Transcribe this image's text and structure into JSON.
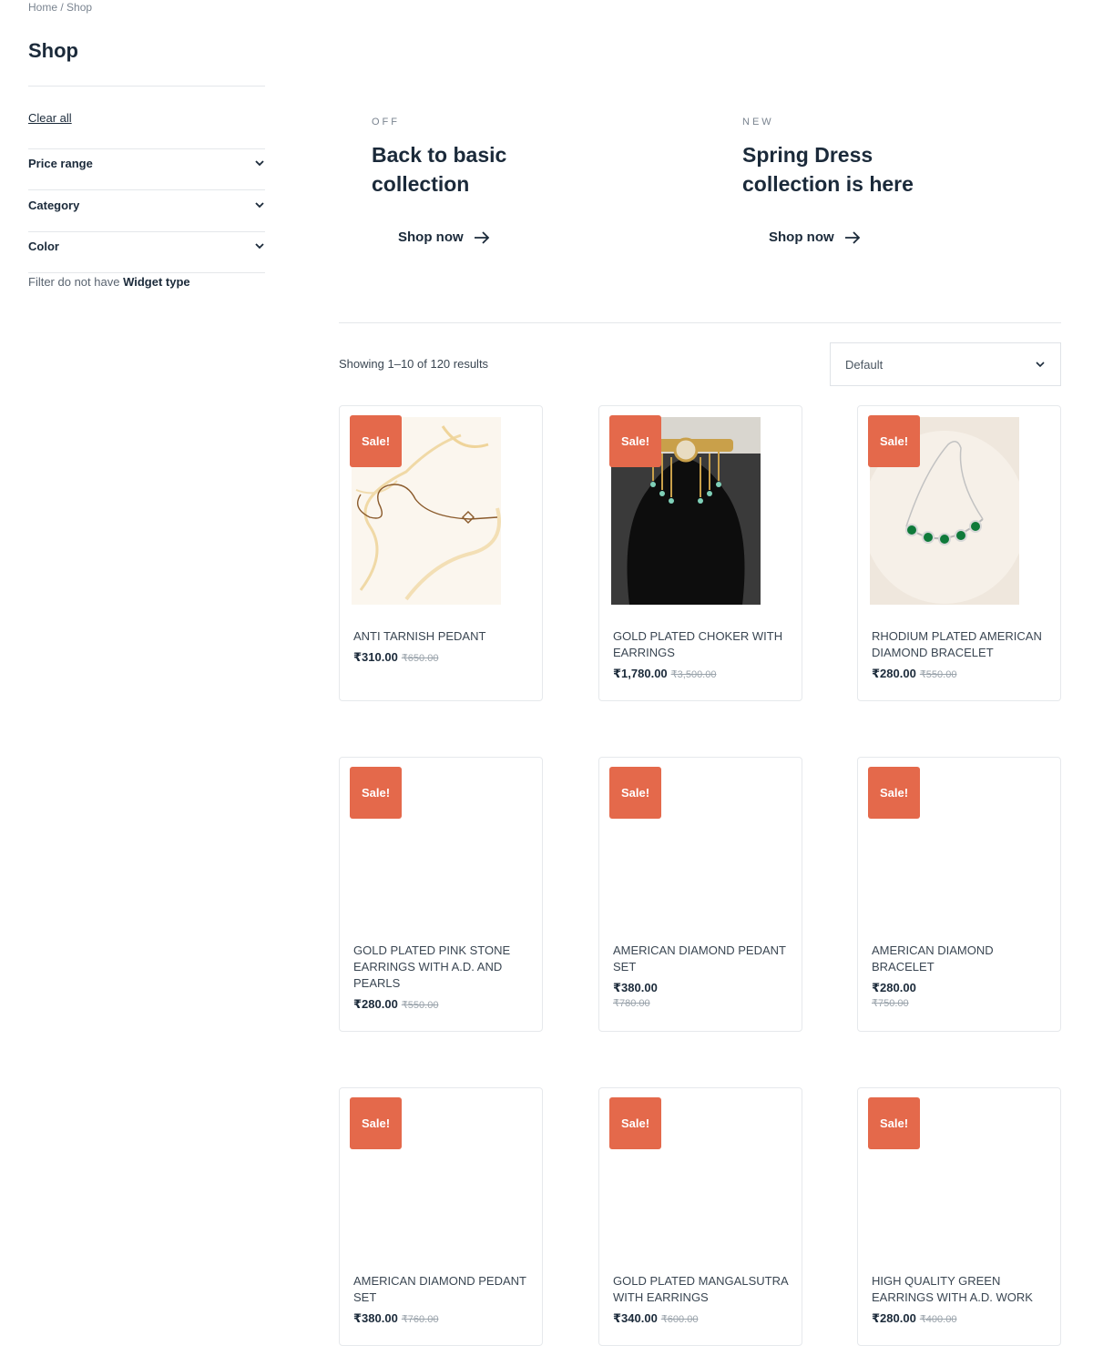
{
  "breadcrumb": "Home / Shop",
  "page_title": "Shop",
  "sidebar": {
    "clear_all": "Clear all",
    "filters": [
      {
        "label": "Price range"
      },
      {
        "label": "Category"
      },
      {
        "label": "Color"
      }
    ],
    "note_prefix": "Filter do not have",
    "note_bold": "Widget type"
  },
  "promos": [
    {
      "tag": "OFF",
      "title_line1": "Back to basic",
      "title_line2": "collection",
      "cta": "Shop now"
    },
    {
      "tag": "NEW",
      "title_line1": "Spring Dress",
      "title_line2": "collection is here",
      "cta": "Shop now"
    }
  ],
  "results_text": "Showing 1–10 of 120 results",
  "sort": {
    "selected": "Default"
  },
  "sale_badge": "Sale!",
  "products": [
    {
      "name": "ANTI TARNISH PEDANT",
      "price": "₹310.00",
      "old_price": "₹650.00"
    },
    {
      "name": "GOLD PLATED CHOKER WITH EARRINGS",
      "price": "₹1,780.00",
      "old_price": "₹3,500.00"
    },
    {
      "name": "RHODIUM PLATED AMERICAN DIAMOND BRACELET",
      "price": "₹280.00",
      "old_price": "₹550.00"
    },
    {
      "name": "GOLD PLATED PINK STONE EARRINGS WITH A.D. AND PEARLS",
      "price": "₹280.00",
      "old_price": "₹550.00"
    },
    {
      "name": "AMERICAN DIAMOND PEDANT SET",
      "price": "₹380.00",
      "old_price": "₹780.00"
    },
    {
      "name": "AMERICAN DIAMOND BRACELET",
      "price": "₹280.00",
      "old_price": "₹750.00"
    },
    {
      "name": "AMERICAN DIAMOND PEDANT SET",
      "price": "₹380.00",
      "old_price": "₹760.00"
    },
    {
      "name": "GOLD PLATED MANGALSUTRA WITH EARRINGS",
      "price": "₹340.00",
      "old_price": "₹600.00"
    },
    {
      "name": "HIGH QUALITY GREEN EARRINGS WITH A.D. WORK",
      "price": "₹280.00",
      "old_price": "₹400.00"
    }
  ],
  "colors": {
    "sale": "#e4694b",
    "text_dark": "#1b2a3a",
    "border": "#e6e9ec"
  }
}
